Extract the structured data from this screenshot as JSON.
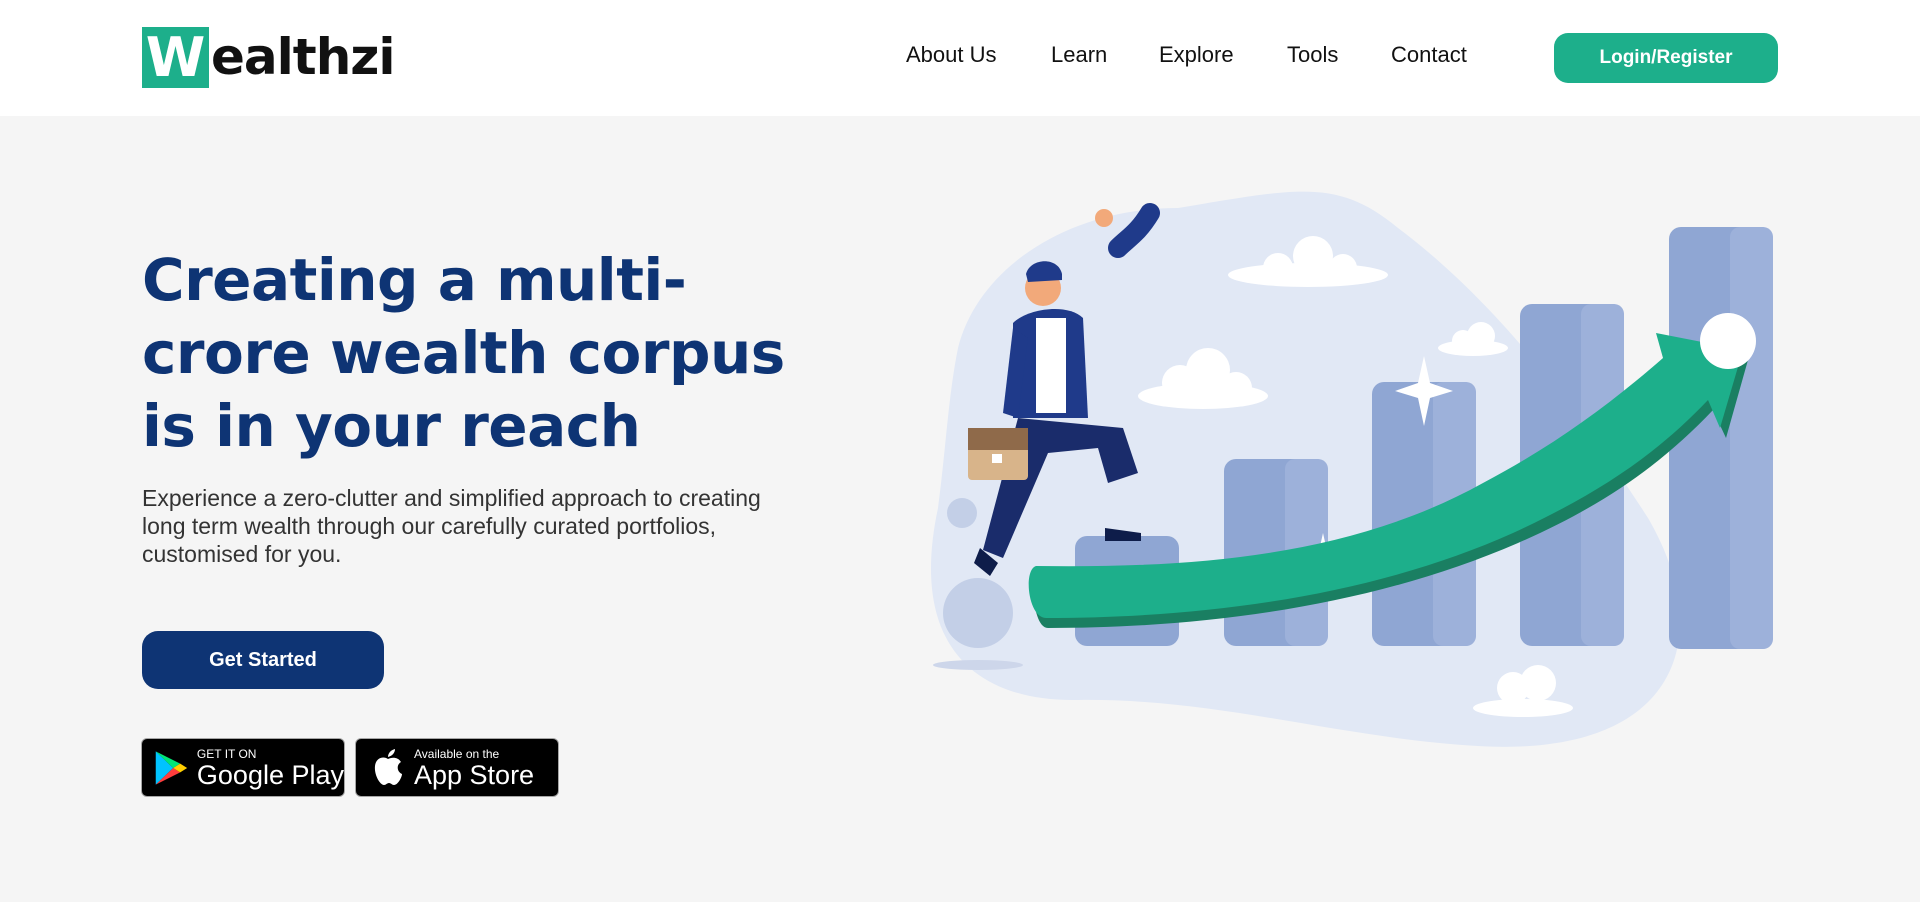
{
  "header": {
    "logo_letter": "W",
    "logo_rest": "ealthzi",
    "nav": [
      "About Us",
      "Learn",
      "Explore",
      "Tools",
      "Contact"
    ],
    "login_label": "Login/Register"
  },
  "hero": {
    "headline_lines": [
      "Creating a multi-",
      "crore wealth corpus",
      "is in your reach"
    ],
    "subtext_lines": [
      "Experience a zero-clutter and simplified approach to creating",
      "long term wealth through our carefully curated portfolios,",
      "customised for you."
    ],
    "cta_label": "Get Started"
  },
  "stores": {
    "google": {
      "small": "GET IT ON",
      "big": "Google Play"
    },
    "apple": {
      "small": "Available on the",
      "big": "App Store"
    }
  },
  "colors": {
    "brand_green": "#1daf8b",
    "brand_navy": "#0e3474",
    "illustration_bg": "#e1e8f5",
    "bar_color": "#8fa6d3"
  }
}
